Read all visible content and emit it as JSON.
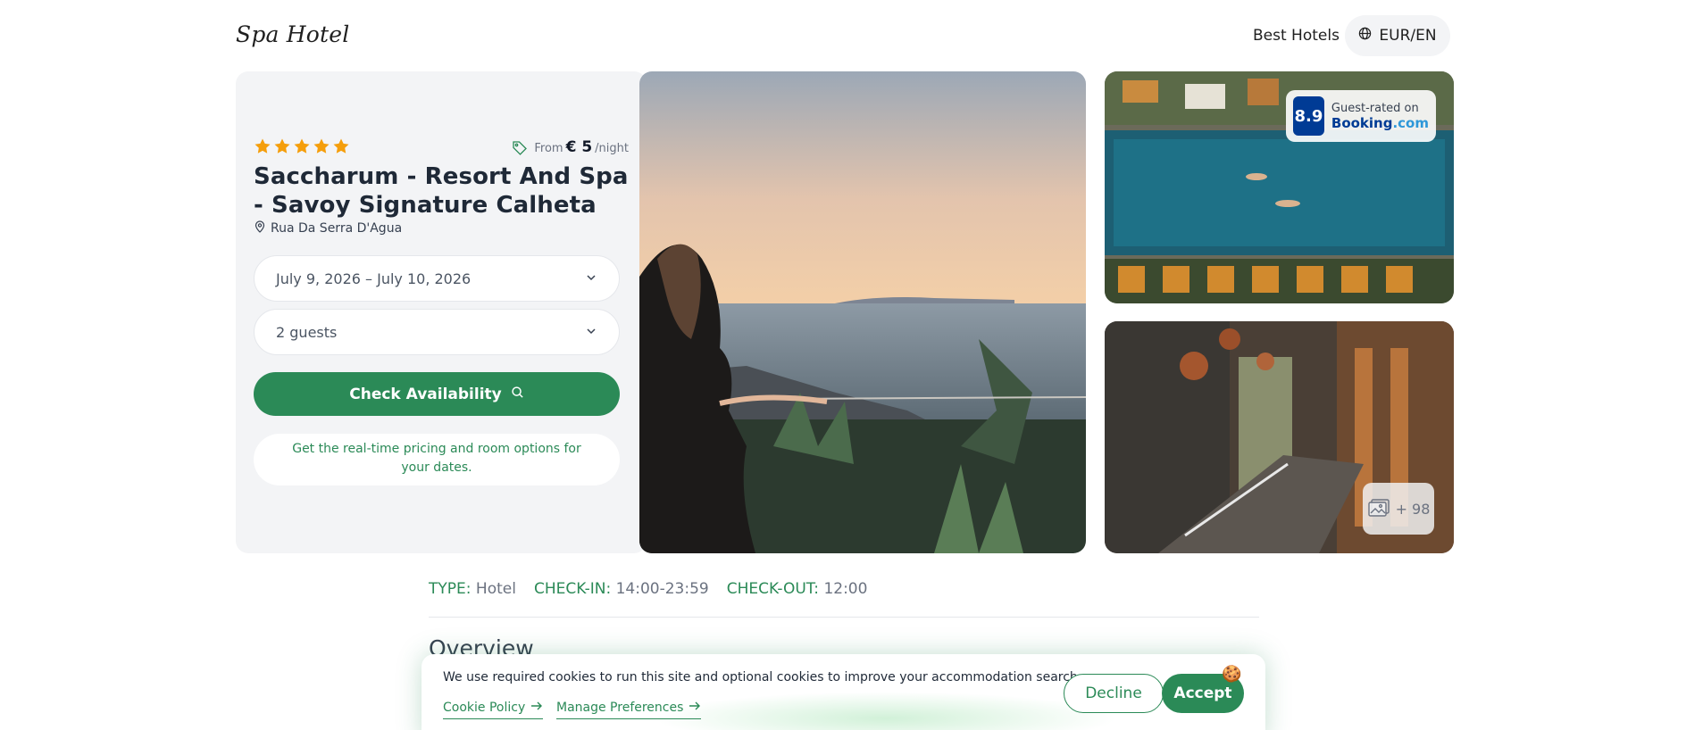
{
  "header": {
    "logo": "Spa Hotel",
    "nav_best_hotels": "Best Hotels",
    "currency_label": "EUR/EN"
  },
  "hotel": {
    "stars": 5,
    "price_prefix": "From",
    "price_amount": "€ 5",
    "price_suffix": "/night",
    "name": "Saccharum - Resort And Spa - Savoy Signature Calheta",
    "address": "Rua Da Serra D'Agua"
  },
  "booking": {
    "dates": "July 9, 2026 – July 10, 2026",
    "guests": "2 guests",
    "check_button": "Check Availability",
    "info": "Get the real-time pricing and room options for your dates."
  },
  "gallery": {
    "rating_score": "8.9",
    "rating_caption": "Guest-rated on",
    "rating_brand": "Booking",
    "rating_brand_suffix": ".com",
    "more_photos": "+ 98"
  },
  "details": {
    "type_label": "TYPE",
    "type_value": "Hotel",
    "checkin_label": "CHECK-IN",
    "checkin_value": "14:00-23:59",
    "checkout_label": "CHECK-OUT",
    "checkout_value": "12:00"
  },
  "overview_title": "Overview",
  "cookie": {
    "text": "We use required cookies to run this site and optional cookies to improve your accommodation search.",
    "policy_link": "Cookie Policy",
    "prefs_link": "Manage Preferences",
    "decline": "Decline",
    "accept": "Accept",
    "emoji": "🍪"
  },
  "colors": {
    "accent": "#2b8a57",
    "star": "#f59e0b",
    "booking_blue": "#003b95",
    "panel_bg": "#f3f4f6"
  },
  "icons": [
    "globe-icon",
    "star-icon",
    "price-tag-icon",
    "location-pin-icon",
    "chevron-down-icon",
    "search-icon",
    "gallery-icon",
    "arrow-right-icon"
  ]
}
